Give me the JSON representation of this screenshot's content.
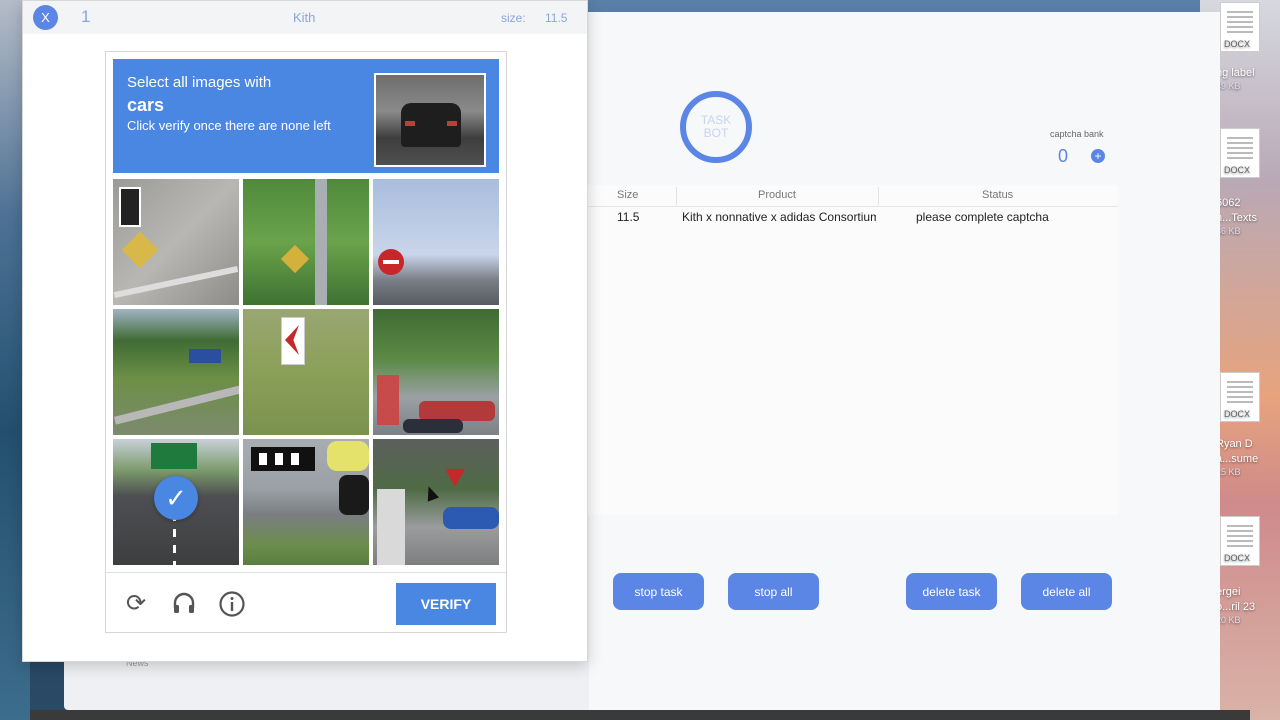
{
  "popup": {
    "close_label": "X",
    "counter": "1",
    "site": "Kith",
    "size_label": "size:",
    "size_value": "11.5"
  },
  "captcha": {
    "instruction_line1": "Select all images with",
    "target_word": "cars",
    "instruction_line2": "Click verify once there are none left",
    "verify_label": "VERIFY",
    "tiles_selected": [
      false,
      false,
      false,
      false,
      false,
      false,
      true,
      false,
      false
    ]
  },
  "app": {
    "logo_line1": "TASK",
    "logo_line2": "BOT",
    "captcha_bank_label": "captcha bank",
    "captcha_bank_value": "0",
    "add_label": "+",
    "columns": [
      "Size",
      "Product",
      "Status"
    ],
    "row": {
      "size": "11.5",
      "product": "Kith x nonnative x adidas Consortium",
      "status": "please complete captcha"
    },
    "buttons": {
      "stop_task": "stop task",
      "stop_all": "stop all",
      "delete_task": "delete task",
      "delete_all": "delete all"
    },
    "news_label": "News"
  },
  "desktop": {
    "icons": [
      {
        "badge": "DOCX",
        "label": "",
        "size": ""
      },
      {
        "badge": "",
        "label": "ng label",
        "size": "49 KB"
      },
      {
        "badge": "DOCX",
        "label": "6062",
        "size": ""
      },
      {
        "badge": "",
        "label": "n...Texts",
        "size": "36 KB"
      },
      {
        "badge": "DOCX",
        "label": "Ryan D",
        "size": ""
      },
      {
        "badge": "",
        "label": "a...sume",
        "size": "25 KB"
      },
      {
        "badge": "DOCX",
        "label": "ergei",
        "size": ""
      },
      {
        "badge": "",
        "label": "o...ril 23",
        "size": "20 KB"
      }
    ]
  }
}
